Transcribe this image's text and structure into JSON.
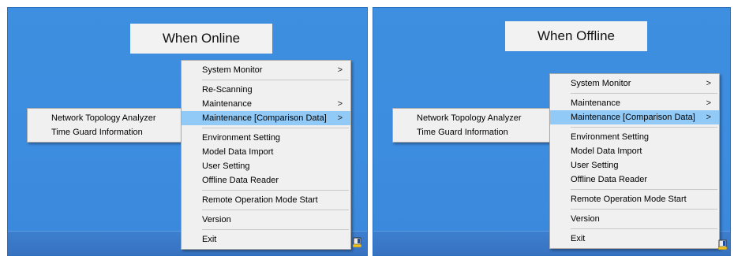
{
  "panels": [
    {
      "caption": "When Online",
      "menu": {
        "system_monitor": "System Monitor",
        "re_scanning": "Re-Scanning",
        "maintenance": "Maintenance",
        "maintenance_comparison": "Maintenance [Comparison Data]",
        "environment_setting": "Environment Setting",
        "model_data_import": "Model Data Import",
        "user_setting": "User Setting",
        "offline_data_reader": "Offline Data Reader",
        "remote_operation": "Remote Operation Mode Start",
        "version": "Version",
        "exit": "Exit"
      },
      "submenu": {
        "network_topology": "Network Topology Analyzer",
        "time_guard": "Time Guard Information"
      }
    },
    {
      "caption": "When Offline",
      "menu": {
        "system_monitor": "System Monitor",
        "maintenance": "Maintenance",
        "maintenance_comparison": "Maintenance [Comparison Data]",
        "environment_setting": "Environment Setting",
        "model_data_import": "Model Data Import",
        "user_setting": "User Setting",
        "offline_data_reader": "Offline Data Reader",
        "remote_operation": "Remote Operation Mode Start",
        "version": "Version",
        "exit": "Exit"
      },
      "submenu": {
        "network_topology": "Network Topology Analyzer",
        "time_guard": "Time Guard Information"
      }
    }
  ],
  "arrow_glyph": ">",
  "colors": {
    "desktop": "#3f8fe0",
    "menu_bg": "#f0f0f0",
    "highlight": "#91c9f7"
  },
  "icons": {
    "submenu_arrow": "chevron-right-icon",
    "tray": "tray-app-icon"
  }
}
